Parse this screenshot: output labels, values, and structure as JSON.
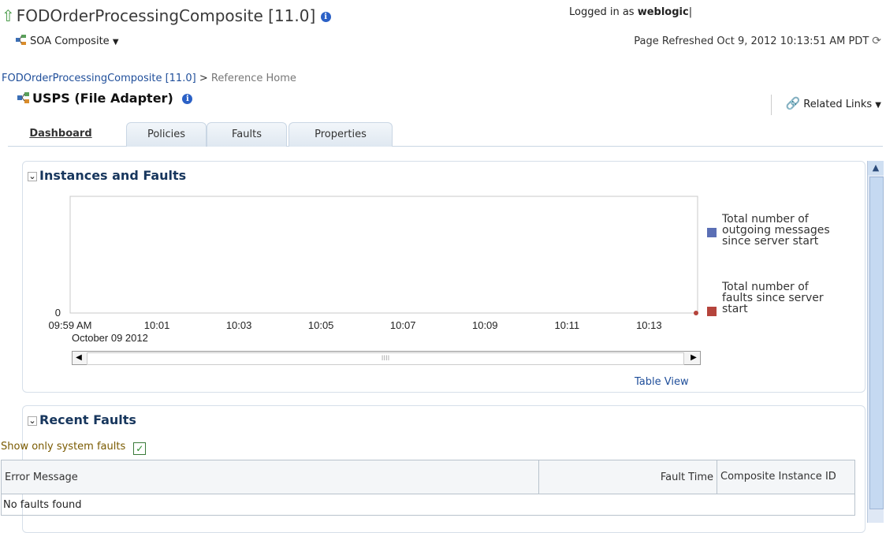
{
  "header": {
    "title": "FODOrderProcessingComposite [11.0]",
    "menu_label": "SOA Composite",
    "login_prefix": "Logged in as",
    "login_user": "weblogic",
    "login_suffix": "|",
    "refresh_text": "Page Refreshed Oct 9, 2012 10:13:51 AM PDT"
  },
  "breadcrumb": {
    "link": "FODOrderProcessingComposite [11.0]",
    "separator": ">",
    "current": "Reference Home"
  },
  "reference": {
    "title": "USPS (File Adapter)",
    "related_links": "Related Links"
  },
  "tabs": [
    {
      "label": "Dashboard",
      "active": true
    },
    {
      "label": "Policies",
      "active": false
    },
    {
      "label": "Faults",
      "active": false
    },
    {
      "label": "Properties",
      "active": false
    }
  ],
  "instances_panel": {
    "title": "Instances and Faults",
    "table_view": "Table View"
  },
  "chart_data": {
    "type": "line",
    "x_ticks": [
      "09:59 AM",
      "10:01",
      "10:03",
      "10:05",
      "10:07",
      "10:09",
      "10:11",
      "10:13"
    ],
    "x_sublabel": "October 09 2012",
    "y_ticks": [
      "0"
    ],
    "series": [
      {
        "name": "Total number of outgoing messages since server start",
        "color": "#5b6fb5",
        "values": [
          0
        ]
      },
      {
        "name": "Total number of faults since server start",
        "color": "#b5443c",
        "values": [
          0
        ]
      }
    ],
    "scroll_thumb_label": "IIII"
  },
  "faults_panel": {
    "title": "Recent Faults",
    "system_faults_label": "Show only system faults",
    "system_faults_checked": true,
    "columns": [
      "Error Message",
      "Fault Time",
      "Composite Instance ID"
    ],
    "empty_text": "No faults found"
  },
  "colors": {
    "accent": "#1f4e9a",
    "panel_title": "#17365d",
    "border": "#d6dfe9"
  }
}
